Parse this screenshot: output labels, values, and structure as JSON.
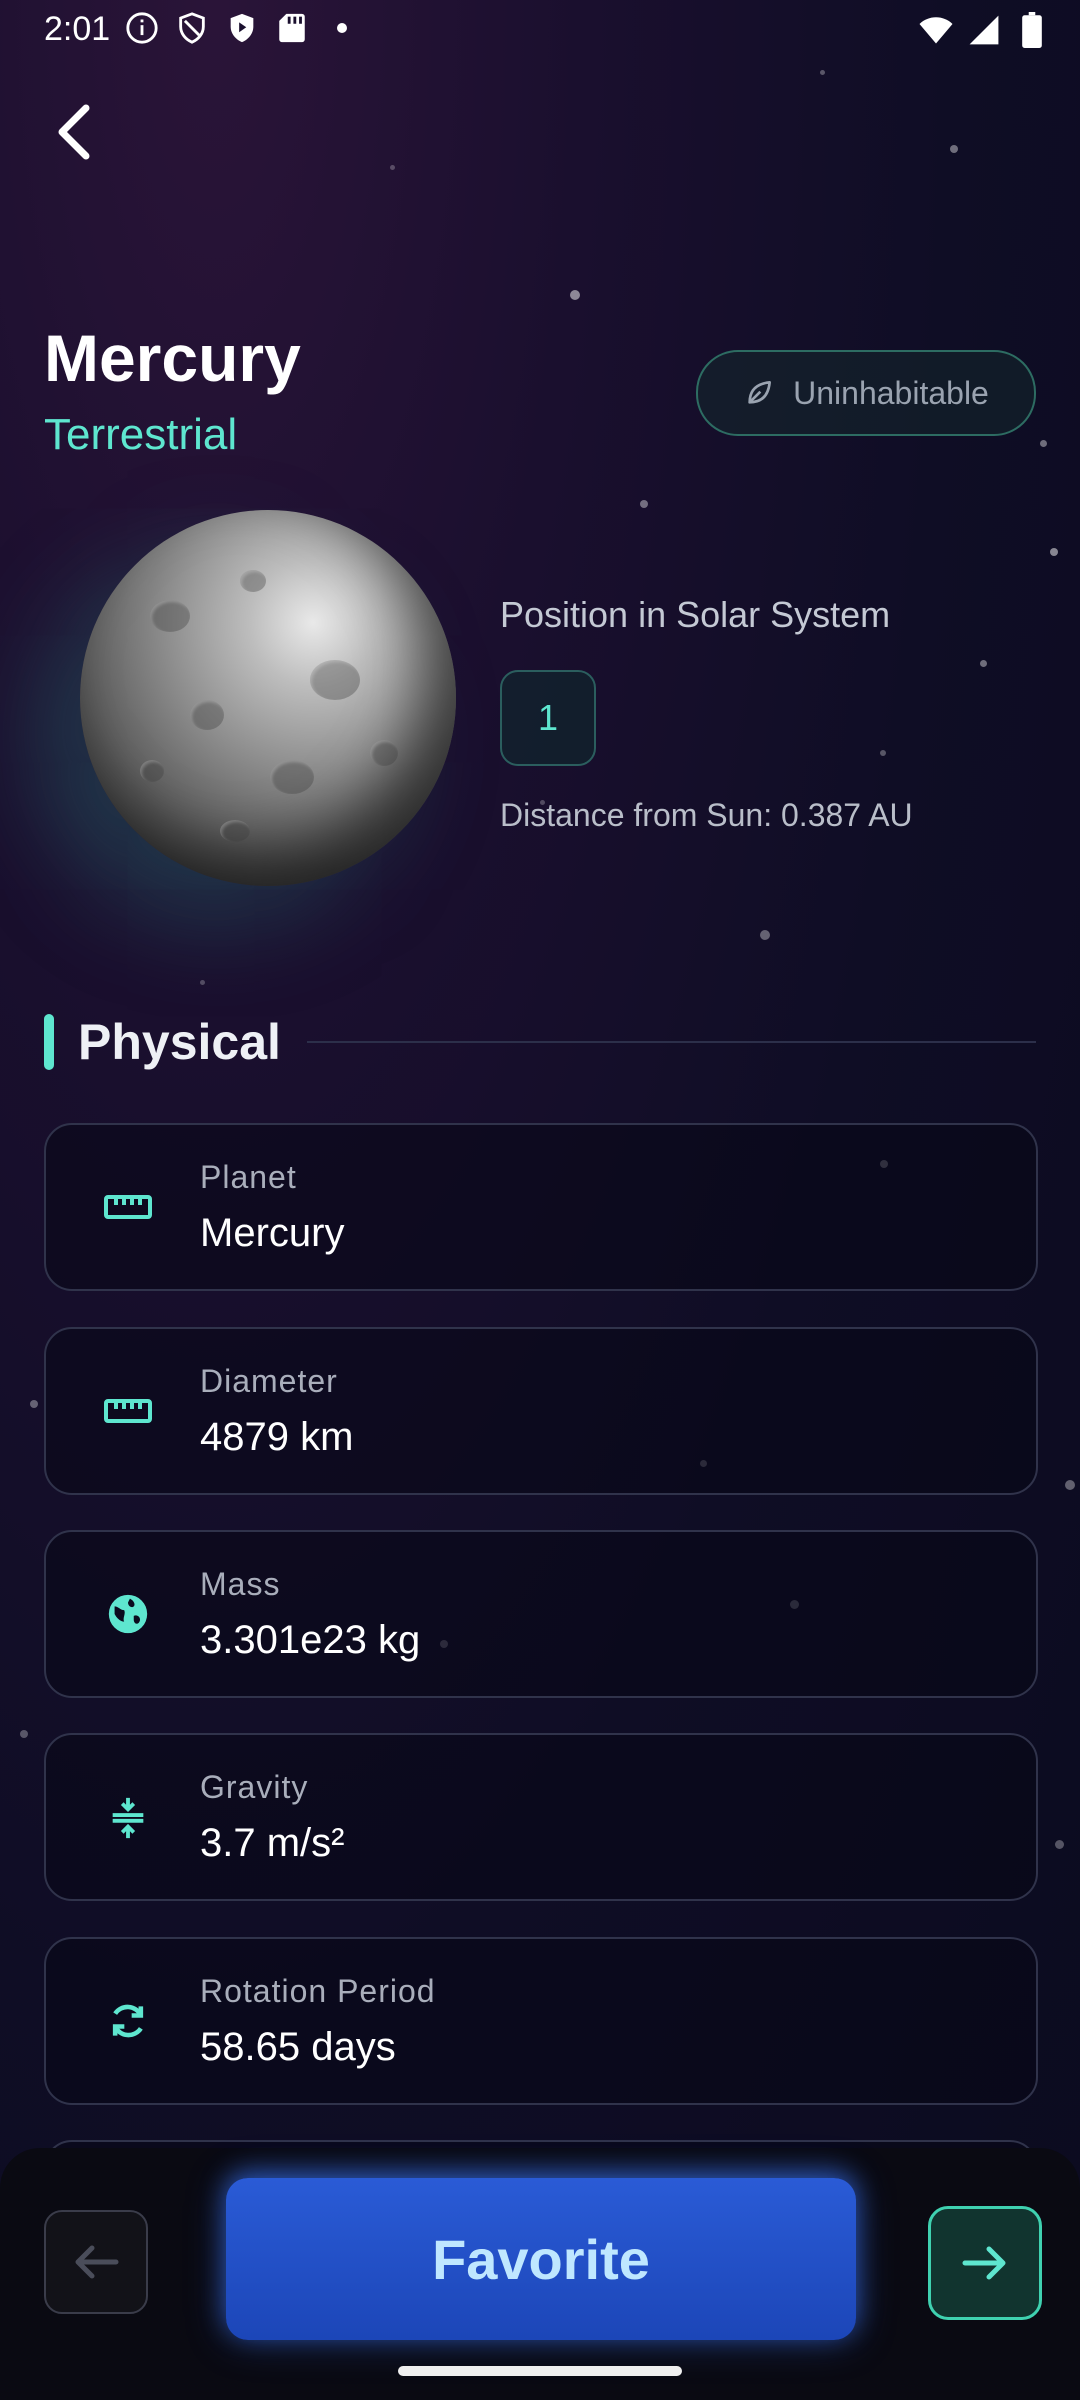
{
  "status_bar": {
    "time": "2:01"
  },
  "planet": {
    "name": "Mercury",
    "type": "Terrestrial",
    "habitability": "Uninhabitable",
    "position_label": "Position in Solar System",
    "position_value": "1",
    "distance_text": "Distance from Sun: 0.387 AU"
  },
  "section": {
    "title": "Physical"
  },
  "stats": [
    {
      "label": "Planet",
      "value": "Mercury",
      "icon": "ruler-icon"
    },
    {
      "label": "Diameter",
      "value": "4879 km",
      "icon": "ruler-icon"
    },
    {
      "label": "Mass",
      "value": "3.301e23 kg",
      "icon": "globe-icon"
    },
    {
      "label": "Gravity",
      "value": "3.7 m/s²",
      "icon": "gravity-icon"
    },
    {
      "label": "Rotation Period",
      "value": "58.65 days",
      "icon": "rotation-icon"
    }
  ],
  "bottom": {
    "favorite_label": "Favorite"
  },
  "colors": {
    "accent": "#5ee6cf",
    "button": "#2a5bd6",
    "background": "#0f0d25"
  }
}
